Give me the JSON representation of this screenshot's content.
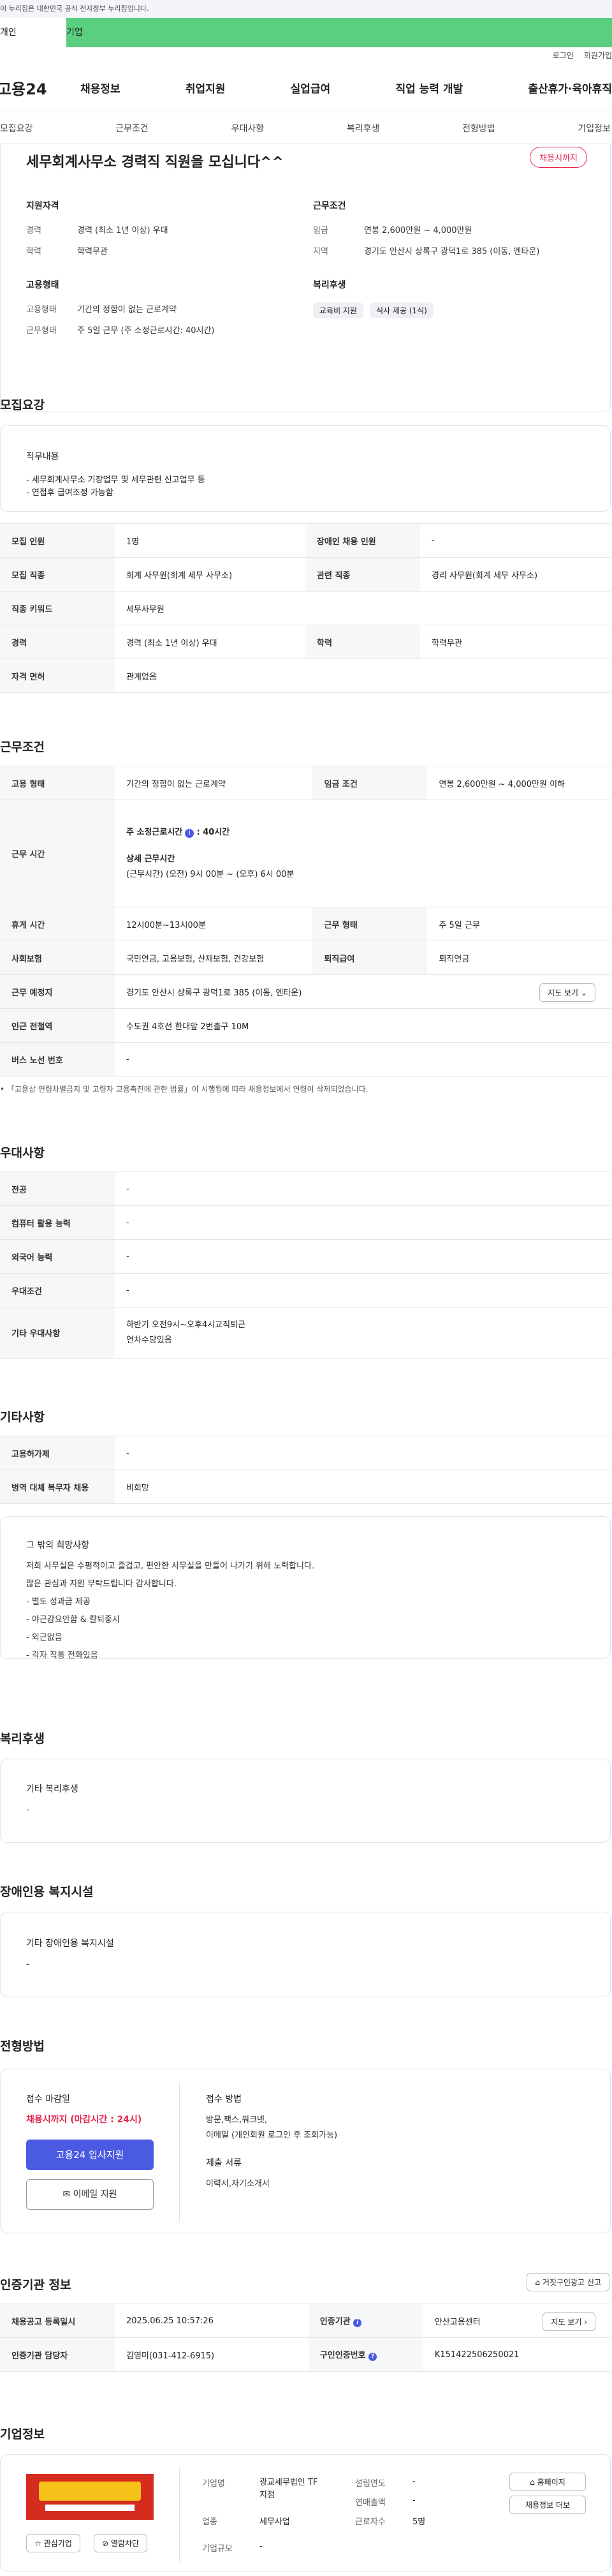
{
  "gov_banner": "이 누리집은 대한민국 공식 전자정부 누리집입니다.",
  "top_tabs": [
    "개인",
    "기업"
  ],
  "util_links": [
    "로그인",
    "회원가입"
  ],
  "logo": "고용24",
  "gnb": [
    "채용정보",
    "취업지원",
    "실업급여",
    "직업 능력 개발",
    "출산휴가·육아휴직"
  ],
  "snb": [
    "모집요강",
    "근무조건",
    "우대사항",
    "복리후생",
    "전형방법",
    "기업정보"
  ],
  "header": {
    "title": "세무회계사무소 경력직 직원을 모십니다^^",
    "badge": "채용시까지",
    "qual_title": "지원자격",
    "qual": [
      {
        "k": "경력",
        "v": "경력 (최소 1년 이상) 우대"
      },
      {
        "k": "학력",
        "v": "학력무관"
      }
    ],
    "cond_title": "근무조건",
    "cond": [
      {
        "k": "임금",
        "v": "연봉 2,600만원 ~ 4,000만원"
      },
      {
        "k": "지역",
        "v": "경기도 안산시 상록구 광덕1로 385 (이동, 엔타운)"
      }
    ],
    "emp_title": "고용형태",
    "emp": [
      {
        "k": "고용형태",
        "v": "기간의 정함이 없는 근로계약"
      },
      {
        "k": "근무형태",
        "v": "주 5일 근무 (주 소정근로시간: 40시간)"
      }
    ],
    "welfare_title": "복리후생",
    "welfare_tags": [
      "교육비 지원",
      "식사 제공 (1식)"
    ]
  },
  "recruit": {
    "title": "모집요강",
    "duty_title": "직무내용",
    "duty_lines": [
      "- 세무회계사무소 기장업무 및 세무관련 신고업무 등",
      "- 연접후 급여조정 가능함"
    ],
    "rows": [
      [
        "모집 인원",
        "1명",
        "장애인 채용 인원",
        "-"
      ],
      [
        "모집 직종",
        "회계 사무원(회계 세무 사무소)",
        "관련 직종",
        "경리 사무원(회계 세무 사무소)"
      ],
      [
        "직종 키워드",
        "세무사무원",
        "",
        ""
      ],
      [
        "경력",
        "경력 (최소 1년 이상) 우대",
        "학력",
        "학력무관"
      ],
      [
        "자격 면허",
        "관계없음",
        "",
        ""
      ]
    ]
  },
  "work": {
    "title": "근무조건",
    "emp_type_k": "고용 형태",
    "emp_type_v": "기간의 정함이 없는 근로계약",
    "wage_k": "임금 조건",
    "wage_v": "연봉 2,600만원 ~ 4,000만원 이하",
    "hours_k": "근무 시간",
    "hours_a": "주 소정근로시간",
    "hours_a2": ": 40시간",
    "hours_b": "상세 근무시간",
    "hours_c": "(근무시간) (오전) 9시 00분 ~ (오후) 6시 00분",
    "break_k": "휴게 시간",
    "break_v": "12시00분~13시00분",
    "shift_k": "근무 형태",
    "shift_v": "주 5일 근무",
    "ins_k": "사회보험",
    "ins_v": "국민연금, 고용보험, 산재보험, 건강보험",
    "ret_k": "퇴직급여",
    "ret_v": "퇴직연금",
    "loc_k": "근무 예정지",
    "loc_v": "경기도 안산시 상록구 광덕1로 385 (이동, 엔타운)",
    "map_btn": "지도 보기",
    "subway_k": "인근 전철역",
    "subway_v": "수도권 4호선 한대앞 2번출구 10M",
    "bus_k": "버스 노선 번호",
    "bus_v": "-",
    "note": "「고용상 연령차별금지 및 고령자 고용촉진에 관한 법률」이 시행됨에 따라 채용정보에서 연령이 삭제되었습니다."
  },
  "pref": {
    "title": "우대사항",
    "rows": [
      [
        "전공",
        "-"
      ],
      [
        "컴퓨터 활용 능력",
        "-"
      ],
      [
        "외국어 능력",
        "-"
      ],
      [
        "우대조건",
        "-"
      ]
    ],
    "extra_k": "기타 우대사항",
    "extra_v": [
      "하반기 오전9시~오후4시교직퇴근",
      "연차수당있음"
    ]
  },
  "etc": {
    "title": "기타사항",
    "rows": [
      [
        "고용허가제",
        "-"
      ],
      [
        "병역 대체 복무자 채용",
        "비희망"
      ]
    ],
    "wish_title": "그 밖의 희망사항",
    "wish_lines": [
      "저희 사무실은 수평적이고 즐겁고, 편안한 사무실을 만들어 나가기 위해 노력합니다.",
      "많은 관심과 지원 부탁드립니다 감사합니다.",
      "- 별도 성과금 제공",
      "- 야근감요안함 & 칼퇴중시",
      "- 외근없음",
      "- 각자 직통 전화있음"
    ]
  },
  "welfare": {
    "title": "복리후생",
    "box_title": "기타 복리후생",
    "box_v": "-"
  },
  "disab": {
    "title": "장애인용 복지시설",
    "box_title": "기타 장애인용 복지시설",
    "box_v": "-"
  },
  "process": {
    "title": "전형방법",
    "deadline_k": "접수 마감일",
    "deadline_v": "채용시까지 (마감시간 : 24시)",
    "apply_btn": "고용24 입사지원",
    "email_btn": "이메일 지원",
    "method_k": "접수 방법",
    "method_v1": "방문,팩스,워크넷,",
    "method_v2": "이메일 (개인회원 로그인 후 조회가능)",
    "docs_k": "제출 서류",
    "docs_v": "이력서,자기소개서"
  },
  "agency": {
    "title": "인증기관 정보",
    "report_btn": "거짓구인광고 신고",
    "r1": [
      "채용공고 등록일시",
      "2025.06.25 10:57:26",
      "인증기관",
      "안산고용센터"
    ],
    "map_btn": "지도 보기",
    "r2": [
      "인증기관 담당자",
      "김영미(031-412-6915)",
      "구인인증번호",
      "K151422506250021"
    ]
  },
  "company": {
    "title": "기업정보",
    "name_k": "기업명",
    "name_v1": "광교세무법인 TF",
    "name_v2": "지점",
    "found_k": "설립연도",
    "found_v": "-",
    "biz_k": "업종",
    "biz_v": "세무사업",
    "sales_k": "연매출액",
    "sales_v": "-",
    "emp_k": "근로자수",
    "emp_v": "5명",
    "scale_k": "기업규모",
    "scale_v": "-",
    "home_btn": "홈페이지",
    "more_btn": "채용정보 더보",
    "fav_btn": "관심기업",
    "block_btn": "열람차단"
  },
  "colors": {
    "accent": "#4b5ae3",
    "brand_green": "#59cf7f",
    "red": "#e6244e"
  }
}
